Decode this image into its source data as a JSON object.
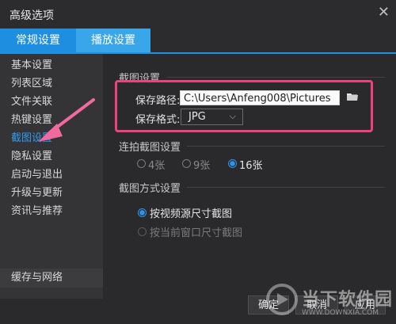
{
  "window": {
    "title": "高级选项",
    "close_glyph": "✕"
  },
  "tabs": [
    {
      "label": "常规设置"
    },
    {
      "label": "播放设置"
    }
  ],
  "sidebar": {
    "items": [
      {
        "label": "基本设置"
      },
      {
        "label": "列表区域"
      },
      {
        "label": "文件关联"
      },
      {
        "label": "热键设置"
      },
      {
        "label": "截图设置"
      },
      {
        "label": "隐私设置"
      },
      {
        "label": "启动与退出"
      },
      {
        "label": "升级与更新"
      },
      {
        "label": "资讯与推荐"
      }
    ],
    "active_label": "截图设置",
    "bottom_item": {
      "label": "缓存与网络"
    }
  },
  "screenshot_settings": {
    "title": "截图设置",
    "save_path_label": "保存路径:",
    "save_path_value": "C:\\Users\\Anfeng008\\Pictures",
    "save_format_label": "保存格式:",
    "save_format_value": "JPG"
  },
  "burst_settings": {
    "title": "连拍截图设置",
    "options": [
      {
        "label": "4张",
        "selected": false
      },
      {
        "label": "9张",
        "selected": false
      },
      {
        "label": "16张",
        "selected": true
      }
    ]
  },
  "method_settings": {
    "title": "截图方式设置",
    "options": [
      {
        "label": "按视频源尺寸截图",
        "selected": true,
        "enabled": true
      },
      {
        "label": "按当前窗口尺寸截图",
        "selected": false,
        "enabled": false
      }
    ]
  },
  "footer": {
    "ok_label": "确定",
    "cancel_label": "取消",
    "apply_label": "应用"
  },
  "watermark": {
    "text": "当下软件园",
    "sub": "WWW.DOWNXIA.COM"
  },
  "colors": {
    "accent": "#1e8fe0",
    "active_text": "#2e9cf0",
    "highlight": "#f0407e",
    "arrow": "#f06aa0"
  }
}
